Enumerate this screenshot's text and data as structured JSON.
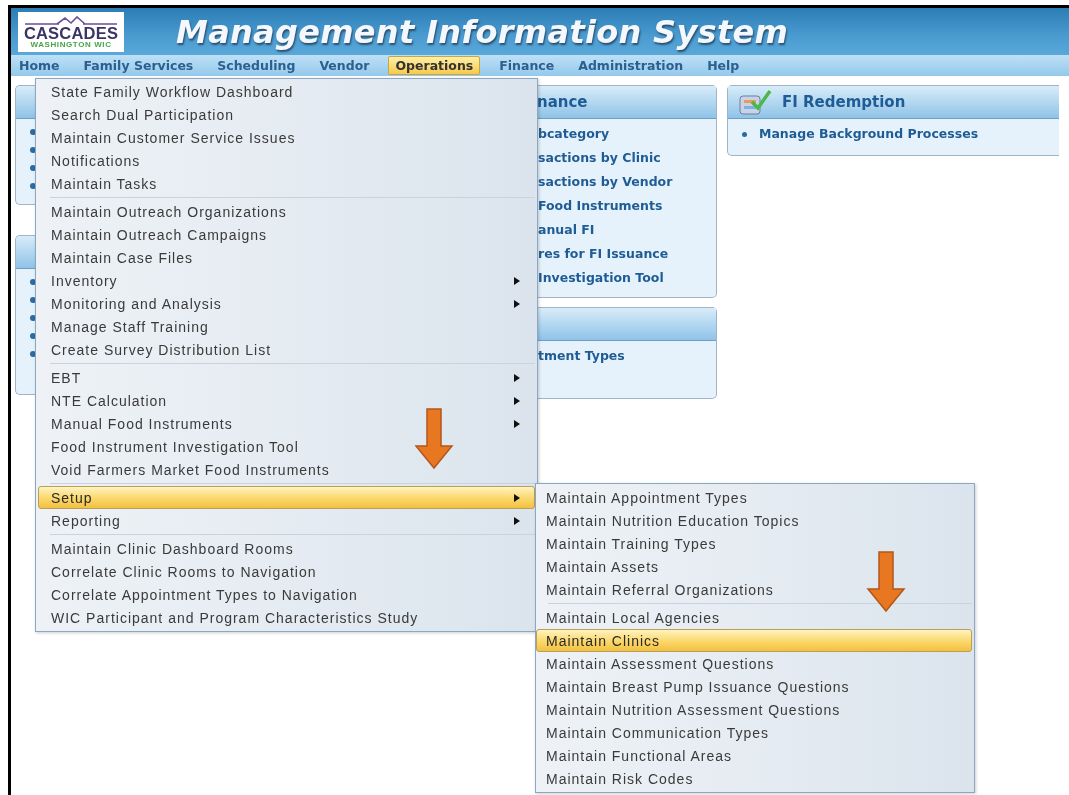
{
  "header": {
    "logo": {
      "name": "CASCADES",
      "tagline": "WASHINGTON WIC"
    },
    "title": "Management Information System"
  },
  "nav": [
    {
      "label": "Home",
      "selected": false
    },
    {
      "label": "Family Services",
      "selected": false
    },
    {
      "label": "Scheduling",
      "selected": false
    },
    {
      "label": "Vendor",
      "selected": false
    },
    {
      "label": "Operations",
      "selected": true
    },
    {
      "label": "Finance",
      "selected": false
    },
    {
      "label": "Administration",
      "selected": false
    },
    {
      "label": "Help",
      "selected": false
    }
  ],
  "panels": [
    {
      "title": "nance",
      "links": [
        "bcategory",
        "sactions by Clinic",
        "sactions by Vendor",
        "Food Instruments",
        "anual FI",
        "res for FI Issuance",
        "Investigation Tool"
      ]
    },
    {
      "links": [
        "tment Types"
      ]
    }
  ],
  "fi_redemption": {
    "title": "FI Redemption",
    "links": [
      "Manage Background Processes"
    ]
  },
  "operations_menu": {
    "groups": [
      [
        {
          "label": "State Family Workflow Dashboard",
          "submenu": false,
          "selected": false
        },
        {
          "label": "Search Dual Participation",
          "submenu": false,
          "selected": false
        },
        {
          "label": "Maintain Customer Service Issues",
          "submenu": false,
          "selected": false
        },
        {
          "label": "Notifications",
          "submenu": false,
          "selected": false
        },
        {
          "label": "Maintain Tasks",
          "submenu": false,
          "selected": false
        }
      ],
      [
        {
          "label": "Maintain Outreach Organizations",
          "submenu": false,
          "selected": false
        },
        {
          "label": "Maintain Outreach Campaigns",
          "submenu": false,
          "selected": false
        },
        {
          "label": "Maintain Case Files",
          "submenu": false,
          "selected": false
        },
        {
          "label": "Inventory",
          "submenu": true,
          "selected": false
        },
        {
          "label": "Monitoring and Analysis",
          "submenu": true,
          "selected": false
        },
        {
          "label": "Manage Staff Training",
          "submenu": false,
          "selected": false
        },
        {
          "label": "Create Survey Distribution List",
          "submenu": false,
          "selected": false
        }
      ],
      [
        {
          "label": "EBT",
          "submenu": true,
          "selected": false
        },
        {
          "label": "NTE Calculation",
          "submenu": true,
          "selected": false
        },
        {
          "label": "Manual Food Instruments",
          "submenu": true,
          "selected": false
        },
        {
          "label": "Food Instrument Investigation Tool",
          "submenu": false,
          "selected": false
        },
        {
          "label": "Void Farmers Market Food Instruments",
          "submenu": false,
          "selected": false
        }
      ],
      [
        {
          "label": "Setup",
          "submenu": true,
          "selected": true
        },
        {
          "label": "Reporting",
          "submenu": true,
          "selected": false
        }
      ],
      [
        {
          "label": "Maintain Clinic Dashboard Rooms",
          "submenu": false,
          "selected": false
        },
        {
          "label": "Correlate Clinic Rooms to Navigation",
          "submenu": false,
          "selected": false
        },
        {
          "label": "Correlate Appointment Types to Navigation",
          "submenu": false,
          "selected": false
        },
        {
          "label": "WIC Participant and Program Characteristics Study",
          "submenu": false,
          "selected": false
        }
      ]
    ]
  },
  "setup_menu": {
    "groups": [
      [
        {
          "label": "Maintain Appointment Types",
          "submenu": false,
          "selected": false
        },
        {
          "label": "Maintain Nutrition Education Topics",
          "submenu": false,
          "selected": false
        },
        {
          "label": "Maintain Training Types",
          "submenu": false,
          "selected": false
        },
        {
          "label": "Maintain Assets",
          "submenu": false,
          "selected": false
        },
        {
          "label": "Maintain Referral Organizations",
          "submenu": false,
          "selected": false
        }
      ],
      [
        {
          "label": "Maintain Local Agencies",
          "submenu": false,
          "selected": false
        },
        {
          "label": "Maintain Clinics",
          "submenu": false,
          "selected": true
        },
        {
          "label": "Maintain Assessment Questions",
          "submenu": false,
          "selected": false
        },
        {
          "label": "Maintain Breast Pump Issuance Questions",
          "submenu": false,
          "selected": false
        },
        {
          "label": "Maintain Nutrition Assessment Questions",
          "submenu": false,
          "selected": false
        },
        {
          "label": "Maintain Communication Types",
          "submenu": false,
          "selected": false
        },
        {
          "label": "Maintain Functional Areas",
          "submenu": false,
          "selected": false
        },
        {
          "label": "Maintain Risk Codes",
          "submenu": false,
          "selected": false
        }
      ]
    ]
  }
}
